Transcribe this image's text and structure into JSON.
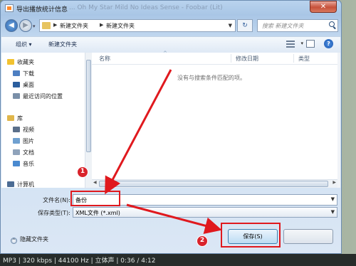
{
  "window": {
    "title": "导出播放统计信息",
    "ghost_title": "... Oh My Star Mild No Ideas Sense - Foobar (Lit)",
    "close_glyph": "✕"
  },
  "navigation": {
    "back_glyph": "◀",
    "forward_glyph": "▶",
    "breadcrumb": [
      "新建文件夹",
      "新建文件夹"
    ],
    "refresh_glyph": "↻",
    "search_placeholder": "搜索 新建文件夹"
  },
  "toolbar": {
    "organize_label": "组织 ▾",
    "new_folder_label": "新建文件夹"
  },
  "nav_pane": {
    "favorites": [
      {
        "label": "收藏夹",
        "icon": "star-icon",
        "color": "#f2c230"
      },
      {
        "label": "下载",
        "icon": "download-folder-icon",
        "color": "#4d7fc2"
      },
      {
        "label": "桌面",
        "icon": "desktop-icon",
        "color": "#2b5e9e"
      },
      {
        "label": "最近访问的位置",
        "icon": "recent-places-icon",
        "color": "#7a8fa8"
      }
    ],
    "libraries": [
      {
        "label": "库",
        "icon": "library-icon",
        "color": "#e0b64a"
      },
      {
        "label": "视频",
        "icon": "video-icon",
        "color": "#5a6f8a"
      },
      {
        "label": "图片",
        "icon": "pictures-icon",
        "color": "#6fa0d0"
      },
      {
        "label": "文档",
        "icon": "documents-icon",
        "color": "#8fa3bb"
      },
      {
        "label": "音乐",
        "icon": "music-icon",
        "color": "#4a8ad0"
      }
    ],
    "computer": {
      "label": "计算机",
      "icon": "computer-icon",
      "color": "#4c6c94"
    }
  },
  "file_list": {
    "columns": [
      "名称",
      "修改日期",
      "类型"
    ],
    "empty_message": "没有与搜索条件匹配的项。"
  },
  "form": {
    "filename_label": "文件名(N):",
    "filename_value": "备份",
    "filetype_label": "保存类型(T):",
    "filetype_value": "XML文件 (*.xml)",
    "hide_folders_label": "隐藏文件夹",
    "save_label": "保存(S)"
  },
  "annotations": {
    "badge_1": "1",
    "badge_2": "2",
    "color": "#e0191e"
  },
  "status_bar": {
    "text": "MP3 | 320 kbps | 44100 Hz | 立体声 | 0:36 / 4:12"
  }
}
